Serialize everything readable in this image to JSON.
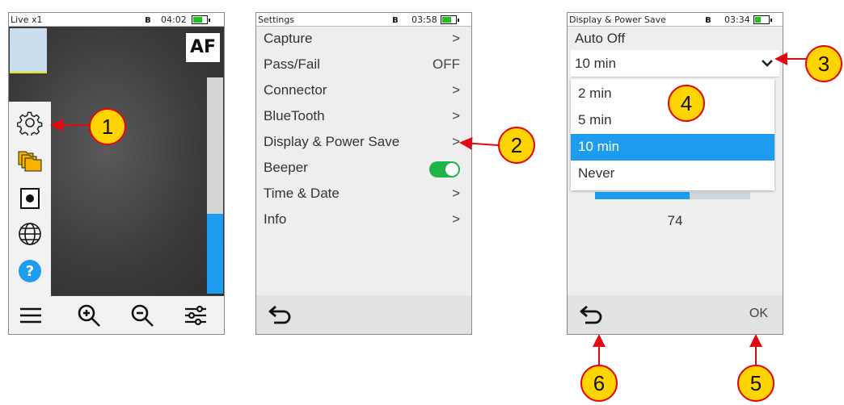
{
  "screen1": {
    "status": {
      "title": "Live x1",
      "time": "04:02",
      "battery_level": 0.7
    },
    "af_label": "AF",
    "zoom_level": 0.37,
    "sidebar_icons": [
      "settings-gear-icon",
      "folders-icon",
      "capture-icon",
      "globe-icon",
      "help-icon"
    ],
    "bottom_icons": [
      "menu-icon",
      "zoom-in-icon",
      "zoom-out-icon",
      "adjust-sliders-icon"
    ]
  },
  "screen2": {
    "status": {
      "title": "Settings",
      "time": "03:58",
      "battery_level": 0.7
    },
    "items": [
      {
        "label": "Capture",
        "value": ">"
      },
      {
        "label": "Pass/Fail",
        "value": "OFF"
      },
      {
        "label": "Connector",
        "value": ">"
      },
      {
        "label": "BlueTooth",
        "value": ">"
      },
      {
        "label": "Display & Power Save",
        "value": ">"
      },
      {
        "label": "Beeper",
        "toggle": true
      },
      {
        "label": "Time & Date",
        "value": ">"
      },
      {
        "label": "Info",
        "value": ">"
      }
    ]
  },
  "screen3": {
    "status": {
      "title": "Display & Power Save",
      "time": "03:34",
      "battery_level": 0.5
    },
    "section_title": "Auto Off",
    "selected": "10 min",
    "options": [
      "2 min",
      "5 min",
      "10 min",
      "Never"
    ],
    "brightness_value": "74",
    "brightness_level": 0.61,
    "ok_label": "OK"
  },
  "callouts": [
    "1",
    "2",
    "3",
    "4",
    "5",
    "6"
  ],
  "colors": {
    "accent": "#1e9cf0",
    "callout_fill": "#ffd500",
    "callout_border": "#e30613",
    "toggle_on": "#1fb44a"
  }
}
